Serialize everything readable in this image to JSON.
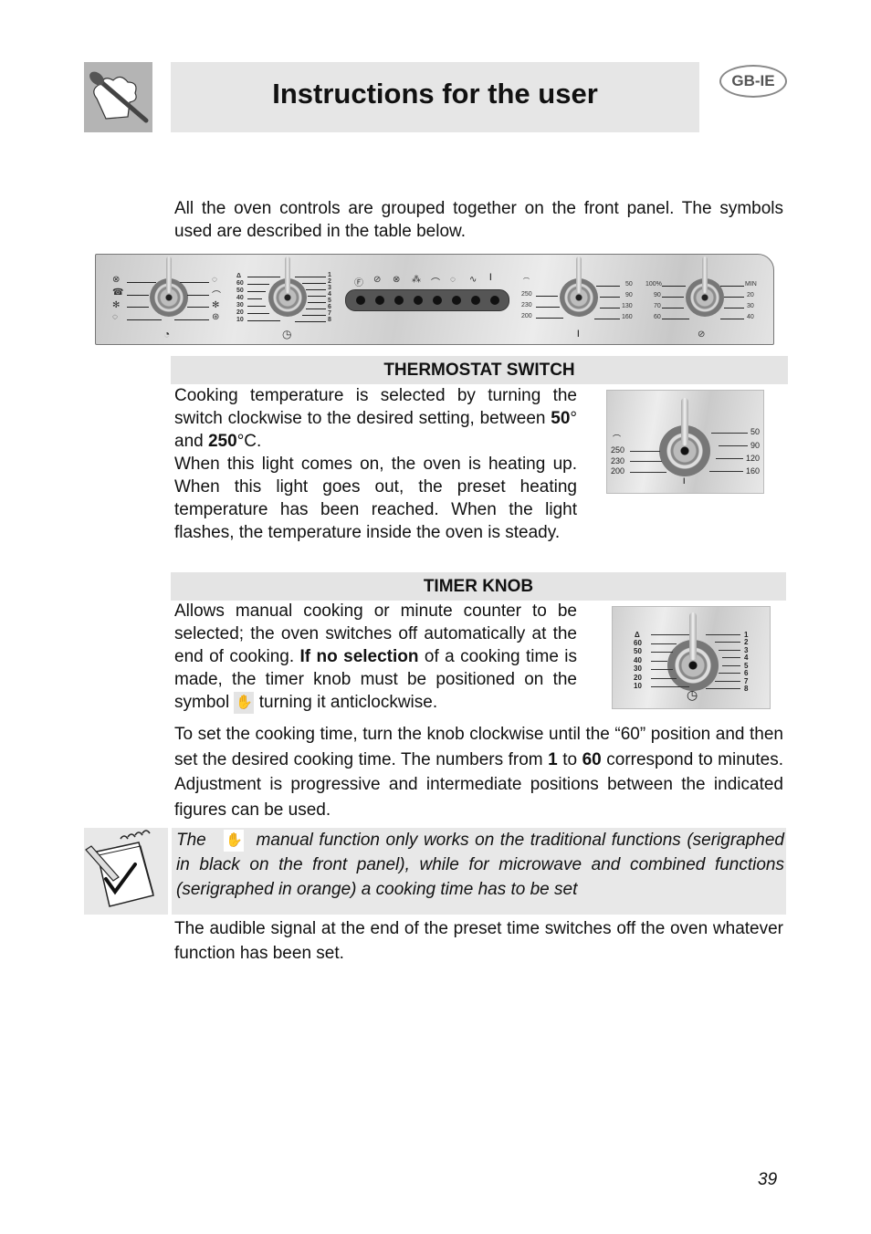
{
  "header": {
    "title": "Instructions for the user",
    "language_badge": "GB-IE",
    "logo_icon": "chef-hat-spoon-icon"
  },
  "intro": "All the oven controls are grouped together on the front panel. The symbols used are described in the table below.",
  "panel": {
    "function_knob": {
      "left_symbols": [
        "fan-grill-icon",
        "grill-fan-icon",
        "defrost-fan-icon",
        "circular-element-icon"
      ],
      "right_symbols": [
        "bottom-heat-icon",
        "top-heat-icon",
        "defrost-icon",
        "fan-icon"
      ],
      "bottom_symbol": "manual-icon"
    },
    "timer_knob": {
      "left_labels": [
        "Δ",
        "60",
        "50",
        "40",
        "30",
        "20",
        "10"
      ],
      "right_labels": [
        "1",
        "2",
        "3",
        "4",
        "5",
        "6",
        "7",
        "8"
      ],
      "bottom_symbol": "clock-icon"
    },
    "indicator_symbols": [
      "f-icon",
      "microwave-grill-icon",
      "fan-grill-icon",
      "defrost-icon",
      "top-heat-icon",
      "circular-icon",
      "microwave-wave-icon",
      "thermometer-icon"
    ],
    "thermostat_knob": {
      "left_labels": [
        "250",
        "230",
        "200"
      ],
      "right_labels": [
        "50",
        "90",
        "130",
        "160"
      ],
      "bottom_symbol": "thermometer-icon"
    },
    "microwave_knob": {
      "left_labels": [
        "100%",
        "90",
        "70",
        "60"
      ],
      "right_labels": [
        "MIN",
        "20",
        "30",
        "40"
      ],
      "bottom_symbol": "microwave-icon"
    }
  },
  "thermostat": {
    "heading": "THERMOSTAT SWITCH",
    "p1_a": "Cooking temperature is selected by turning the switch clockwise to the desired setting, between ",
    "p1_b1": "50",
    "p1_c": "° and ",
    "p1_b2": "250",
    "p1_d": "°C.",
    "p2": "When this light comes on, the oven is heating up. When this light goes out, the preset heating temperature has been reached. When the light flashes, the temperature inside the oven is steady.",
    "image": {
      "left_labels": [
        "250",
        "230",
        "200"
      ],
      "right_labels": [
        "50",
        "90",
        "120",
        "160"
      ]
    }
  },
  "timer": {
    "heading": "TIMER KNOB",
    "p1_a": "Allows manual cooking or minute counter to be selected; the oven switches off automatically at the end of cooking. ",
    "p1_bold": "If no selection",
    "p1_b": " of a cooking time is made, the timer knob must be positioned on the symbol ",
    "p1_c": " turning it anticlockwise.",
    "p2_a": "To set the cooking time, turn the knob clockwise until the “60” position and then set the desired cooking time. The numbers from ",
    "p2_b1": "1",
    "p2_c": " to ",
    "p2_b2": "60",
    "p2_d": " correspond to minutes. Adjustment is progressive and intermediate positions between the indicated figures can be used.",
    "image": {
      "left_labels": [
        "Δ",
        "60",
        "50",
        "40",
        "30",
        "20",
        "10"
      ],
      "right_labels": [
        "1",
        "2",
        "3",
        "4",
        "5",
        "6",
        "7",
        "8"
      ]
    }
  },
  "note": {
    "a": "The ",
    "b": " manual function only works on the traditional functions (serigraphed in black on the front panel), while for microwave and combined functions (serigraphed in orange) a cooking time has to be set"
  },
  "closing": "The audible signal at the end of the preset time switches off the oven whatever function has been set.",
  "page_number": "39",
  "hand_symbol": "✋"
}
